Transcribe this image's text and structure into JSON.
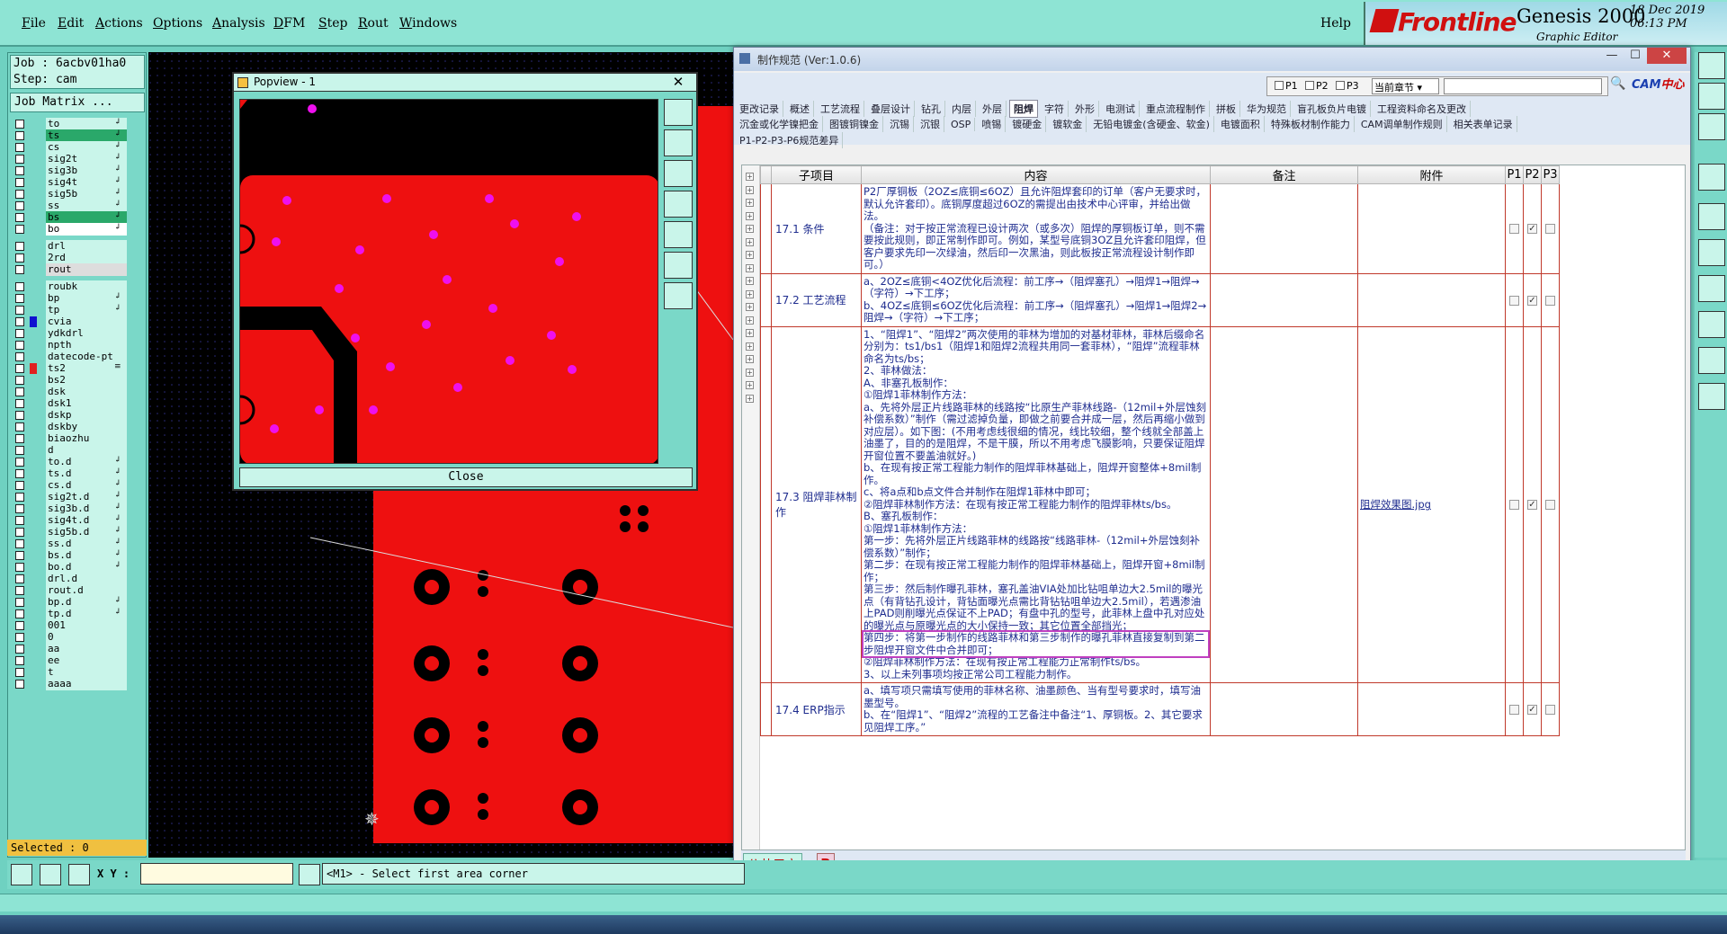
{
  "menu": {
    "items": [
      "File",
      "Edit",
      "Actions",
      "Options",
      "Analysis",
      "DFM",
      "Step",
      "Rout",
      "Windows"
    ],
    "help": "Help"
  },
  "logo": {
    "brand": "Frontline",
    "product": "Genesis 2000",
    "subtitle": "Graphic Editor",
    "date": "18 Dec 2019",
    "time": "06:13 PM"
  },
  "job": {
    "job_line": "Job : 6acbv01ha0",
    "step_line": "Step: cam",
    "matrix_button": "Job Matrix ..."
  },
  "layers": [
    {
      "name": "to",
      "color": "#c9f5ea",
      "arrow": "↲"
    },
    {
      "name": "ts",
      "color": "#2aa86a",
      "arrow": "↲"
    },
    {
      "name": "cs",
      "color": "#c9f5ea",
      "arrow": "↲"
    },
    {
      "name": "sig2t",
      "color": "#c9f5ea",
      "arrow": "↲"
    },
    {
      "name": "sig3b",
      "color": "#c9f5ea",
      "arrow": "↲"
    },
    {
      "name": "sig4t",
      "color": "#c9f5ea",
      "arrow": "↲"
    },
    {
      "name": "sig5b",
      "color": "#c9f5ea",
      "arrow": "↲"
    },
    {
      "name": "ss",
      "color": "#c9f5ea",
      "arrow": "↲"
    },
    {
      "name": "bs",
      "color": "#2aa86a",
      "arrow": "↲"
    },
    {
      "name": "bo",
      "color": "#fff",
      "arrow": "↲"
    },
    {
      "name": "drl",
      "color": "#c9f5ea",
      "arrow": ""
    },
    {
      "name": "2rd",
      "color": "#c9f5ea",
      "arrow": ""
    },
    {
      "name": "rout",
      "color": "#ddd",
      "arrow": ""
    },
    {
      "name": "roubk",
      "color": "#c9f5ea",
      "arrow": ""
    },
    {
      "name": "bp",
      "color": "#c9f5ea",
      "arrow": "↲"
    },
    {
      "name": "tp",
      "color": "#c9f5ea",
      "arrow": "↲"
    },
    {
      "name": "cvia",
      "color": "#c9f5ea",
      "arrow": "",
      "sw": "#1010d0"
    },
    {
      "name": "ydkdrl",
      "color": "#c9f5ea",
      "arrow": ""
    },
    {
      "name": "npth",
      "color": "#c9f5ea",
      "arrow": ""
    },
    {
      "name": "datecode-pt",
      "color": "#c9f5ea",
      "arrow": ""
    },
    {
      "name": "ts2",
      "color": "#c9f5ea",
      "arrow": "≡",
      "sw": "#e02020"
    },
    {
      "name": "bs2",
      "color": "#c9f5ea",
      "arrow": ""
    },
    {
      "name": "dsk",
      "color": "#c9f5ea",
      "arrow": ""
    },
    {
      "name": "dsk1",
      "color": "#c9f5ea",
      "arrow": ""
    },
    {
      "name": "dskp",
      "color": "#c9f5ea",
      "arrow": ""
    },
    {
      "name": "dskby",
      "color": "#c9f5ea",
      "arrow": ""
    },
    {
      "name": "biaozhu",
      "color": "#c9f5ea",
      "arrow": ""
    },
    {
      "name": "d",
      "color": "#c9f5ea",
      "arrow": ""
    },
    {
      "name": "to.d",
      "color": "#c9f5ea",
      "arrow": "↲"
    },
    {
      "name": "ts.d",
      "color": "#c9f5ea",
      "arrow": "↲"
    },
    {
      "name": "cs.d",
      "color": "#c9f5ea",
      "arrow": "↲"
    },
    {
      "name": "sig2t.d",
      "color": "#c9f5ea",
      "arrow": "↲"
    },
    {
      "name": "sig3b.d",
      "color": "#c9f5ea",
      "arrow": "↲"
    },
    {
      "name": "sig4t.d",
      "color": "#c9f5ea",
      "arrow": "↲"
    },
    {
      "name": "sig5b.d",
      "color": "#c9f5ea",
      "arrow": "↲"
    },
    {
      "name": "ss.d",
      "color": "#c9f5ea",
      "arrow": "↲"
    },
    {
      "name": "bs.d",
      "color": "#c9f5ea",
      "arrow": "↲"
    },
    {
      "name": "bo.d",
      "color": "#c9f5ea",
      "arrow": "↲"
    },
    {
      "name": "drl.d",
      "color": "#c9f5ea",
      "arrow": ""
    },
    {
      "name": "rout.d",
      "color": "#c9f5ea",
      "arrow": ""
    },
    {
      "name": "bp.d",
      "color": "#c9f5ea",
      "arrow": "↲"
    },
    {
      "name": "tp.d",
      "color": "#c9f5ea",
      "arrow": "↲"
    },
    {
      "name": "001",
      "color": "#c9f5ea",
      "arrow": ""
    },
    {
      "name": "0",
      "color": "#c9f5ea",
      "arrow": ""
    },
    {
      "name": "aa",
      "color": "#c9f5ea",
      "arrow": ""
    },
    {
      "name": "ee",
      "color": "#c9f5ea",
      "arrow": ""
    },
    {
      "name": "t",
      "color": "#c9f5ea",
      "arrow": ""
    },
    {
      "name": "aaaa",
      "color": "#c9f5ea",
      "arrow": ""
    }
  ],
  "selected": "Selected : 0",
  "cmd": {
    "xy_label": "X Y :",
    "xy_value": "",
    "message": "<M1> - Select first area corner"
  },
  "popview": {
    "title": "Popview - 1",
    "close_label": "Close",
    "close_x": "✕"
  },
  "dialog": {
    "title": "制作规范 (Ver:1.0.6)",
    "filter": {
      "p1": "P1",
      "p2": "P2",
      "p3": "P3",
      "chapter": "当前章节"
    },
    "cam_logo_a": "CAM",
    "cam_logo_b": "中心",
    "tabs_row1": [
      "更改记录",
      "概述",
      "工艺流程",
      "叠层设计",
      "钻孔",
      "内层",
      "外层",
      "阻焊",
      "字符",
      "外形",
      "电测试",
      "重点流程制作",
      "拼板",
      "华为规范",
      "盲孔板负片电镀",
      "工程资料命名及更改"
    ],
    "tabs_row2": [
      "沉金或化学镍把金",
      "图镀铜镍金",
      "沉锡",
      "沉银",
      "OSP",
      "喷锡",
      "镀硬金",
      "镀软金",
      "无铅电镀金(含硬金、软金)",
      "电镀面积",
      "特殊板材制作能力",
      "CAM调单制作规则",
      "相关表单记录"
    ],
    "tabs_row3": [
      "P1-P2-P3-P6规范差异"
    ],
    "active_tab": "阻焊",
    "headers": {
      "sub": "子项目",
      "content": "内容",
      "note": "备注",
      "attach": "附件",
      "p1": "P1",
      "p2": "P2",
      "p3": "P3"
    },
    "rows": [
      {
        "sub": "17.1 条件",
        "lines": [
          "P2厂厚铜板（2OZ≤底铜≤6OZ）且允许阻焊套印的订单（客户无要求时，默认允许套印）。底铜厚度超过6OZ的需提出由技术中心评审，并给出做法。",
          "（备注：对于按正常流程已设计两次（或多次）阻焊的厚铜板订单，则不需要按此规则，即正常制作即可。例如，某型号底铜3OZ且允许套印阻焊，但客户要求先印一次绿油，然后印一次黑油，则此板按正常流程设计制作即可。）"
        ],
        "attach": "",
        "p1": false,
        "p2": true,
        "p3": false
      },
      {
        "sub": "17.2 工艺流程",
        "lines": [
          "a、2OZ≤底铜<4OZ优化后流程：前工序→（阻焊塞孔）→阻焊1→阻焊→（字符）→下工序；",
          "b、4OZ≤底铜≤6OZ优化后流程：前工序→（阻焊塞孔）→阻焊1→阻焊2→阻焊→（字符）→下工序；"
        ],
        "attach": "",
        "p1": false,
        "p2": true,
        "p3": false
      },
      {
        "sub": "17.3 阻焊菲林制作",
        "lines": [
          "1、“阻焊1”、“阻焊2”两次使用的菲林为增加的对基材菲林，菲林后缀命名分别为：ts1/bs1（阻焊1和阻焊2流程共用同一套菲林），“阻焊”流程菲林命名为ts/bs；",
          "2、菲林做法：",
          "A、非塞孔板制作：",
          "①阻焊1菲林制作方法：",
          "a、先将外层正片线路菲林的线路按“比原生产菲林线路-（12mil+外层蚀刻补偿系数）”制作（需过滤掉负量，即做之前要合并成一层，然后再缩小做到对应层）。如下图：(不用考虑线很细的情况，线比较细，整个线就全部盖上油墨了，目的的是阻焊，不是干膜，所以不用考虑飞膜影响，只要保证阻焊开窗位置不要盖油就好。)",
          "b、在现有按正常工程能力制作的阻焊菲林基础上，阻焊开窗整体+8mil制作。",
          "c、将a点和b点文件合并制作在阻焊1菲林中即可；",
          "②阻焊菲林制作方法：在现有按正常工程能力制作的阻焊菲林ts/bs。",
          "B、塞孔板制作：",
          "①阻焊1菲林制作方法：",
          "第一步：先将外层正片线路菲林的线路按“线路菲林-（12mil+外层蚀刻补偿系数）”制作；",
          "第二步：在现有按正常工程能力制作的阻焊菲林基础上，阻焊开窗+8mil制作；",
          "第三步：然后制作曝孔菲林，塞孔盖油VIA处加比钻咀单边大2.5mil的曝光点（有背钻孔设计，背钻面曝光点需比背钻钻咀单边大2.5mil），若遇渗油上PAD则削曝光点保证不上PAD；有盘中孔的型号，此菲林上盘中孔对应处的曝光点与原曝光点的大小保持一致；其它位置全部挡光；",
          "第四步：将第一步制作的线路菲林和第三步制作的曝孔菲林直接复制到第二步阻焊开窗文件中合并即可；",
          "②阻焊菲林制作方法：在现有按正常工程能力正常制作ts/bs。",
          "3、以上未列事项均按正常公司工程能力制作。"
        ],
        "highlight": 13,
        "attach": "阻焊效果图.jpg",
        "p1": false,
        "p2": true,
        "p3": false
      },
      {
        "sub": "17.4 ERP指示",
        "lines": [
          "a、填写项只需填写使用的菲林名称、油墨颜色、当有型号要求时，填写油墨型号。",
          "b、在“阻焊1”、“阻焊2”流程的工艺备注中备注“1、厚铜板。2、其它要求见阻焊工序。”"
        ],
        "attach": "",
        "p1": false,
        "p2": true,
        "p3": false
      }
    ],
    "footer": {
      "public_user": "公共用户",
      "r": "R"
    }
  }
}
